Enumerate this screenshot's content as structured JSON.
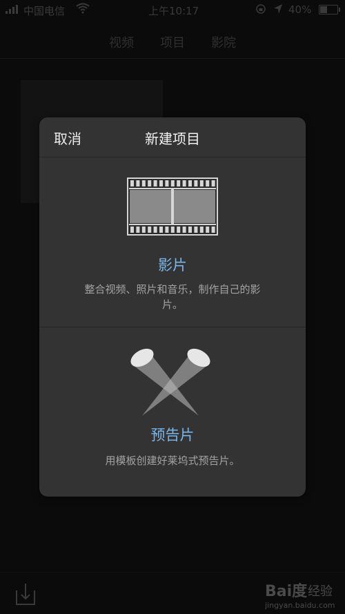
{
  "status_bar": {
    "carrier": "中国电信",
    "time": "上午10:17",
    "battery": "40%",
    "battery_level": 0.4
  },
  "top_tabs": [
    "视频",
    "项目",
    "影院"
  ],
  "modal": {
    "cancel_label": "取消",
    "title": "新建项目",
    "options": [
      {
        "icon": "filmstrip-icon",
        "title": "影片",
        "description": "整合视频、照片和音乐，制作自己的影片。"
      },
      {
        "icon": "spotlights-icon",
        "title": "预告片",
        "description": "用模板创建好莱坞式预告片。"
      }
    ]
  },
  "bottom_bar": {
    "import_icon": "import-icon"
  },
  "watermark": {
    "logo": "Bai度",
    "label": "经验",
    "url": "jingyan.baidu.com"
  },
  "colors": {
    "accent": "#79b6e9",
    "modal_bg": "#333333",
    "background": "#0b0b0b"
  }
}
